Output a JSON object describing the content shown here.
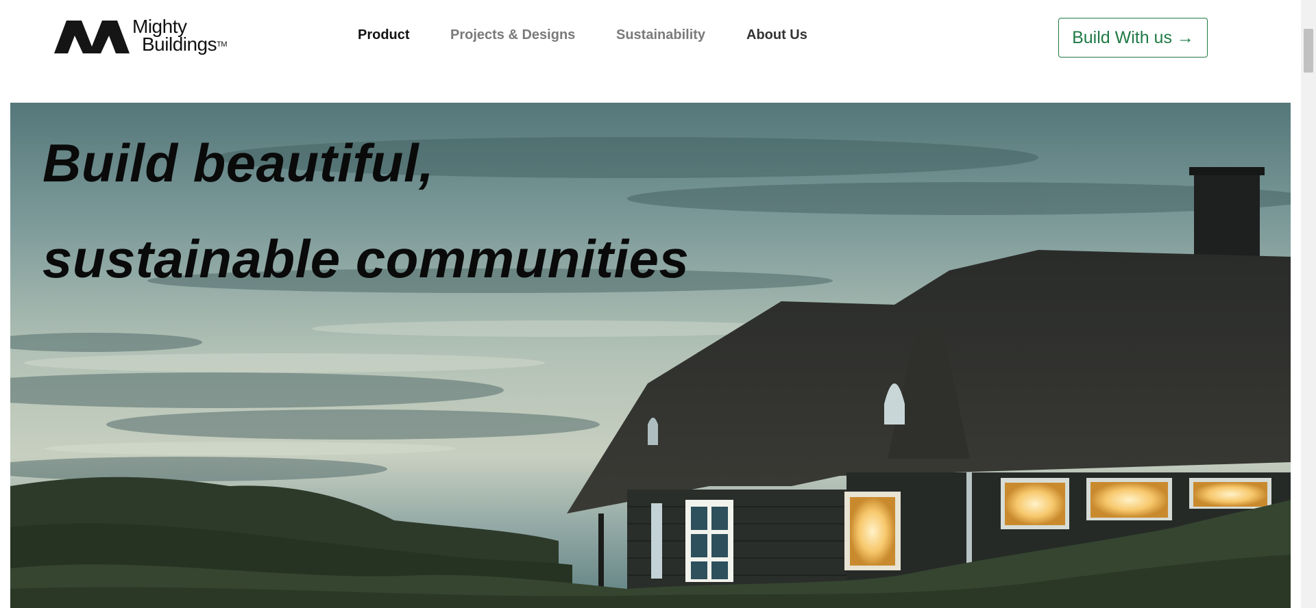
{
  "brand": {
    "name_line1": "Mighty",
    "name_line2": "Buildings",
    "trademark": "TM",
    "logo_icon": "mighty-buildings-mark"
  },
  "nav": {
    "items": [
      {
        "label": "Product",
        "active": true
      },
      {
        "label": "Projects & Designs",
        "active": false
      },
      {
        "label": "Sustainability",
        "active": false
      },
      {
        "label": "About Us",
        "active": false
      }
    ]
  },
  "cta": {
    "label": "Build With us →"
  },
  "hero": {
    "headline_line1": "Build beautiful,",
    "headline_line2": "sustainable communities",
    "image": "thatched-roof-house-at-dusk"
  },
  "colors": {
    "accent": "#1f7a46",
    "nav_active": "#111111",
    "nav_inactive": "#7a7a7a",
    "headline": "#0a0a0a"
  }
}
